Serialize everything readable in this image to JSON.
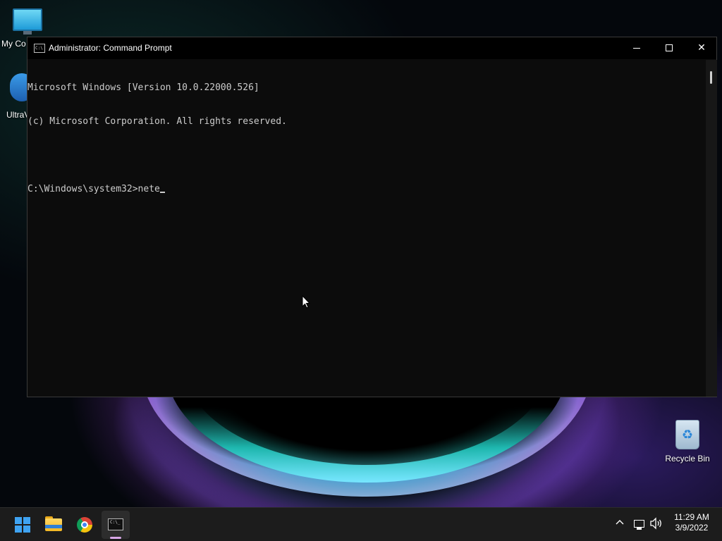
{
  "desktop": {
    "icons": [
      {
        "label": "My Co",
        "icon": "monitor-icon"
      },
      {
        "label": "UltraV",
        "icon": "ultraviewer-icon"
      },
      {
        "label": "Recycle Bin",
        "icon": "recycle-bin-icon"
      }
    ]
  },
  "window": {
    "title": "Administrator: Command Prompt",
    "app_icon_text": "C:\\",
    "controls": {
      "minimize": "minimize",
      "maximize": "maximize",
      "close": "✕"
    }
  },
  "console": {
    "lines": [
      "Microsoft Windows [Version 10.0.22000.526]",
      "(c) Microsoft Corporation. All rights reserved.",
      ""
    ],
    "prompt": "C:\\Windows\\system32>",
    "input": "nete"
  },
  "taskbar": {
    "apps": [
      {
        "name": "Start",
        "icon": "windows-start-icon"
      },
      {
        "name": "File Explorer",
        "icon": "folder-icon"
      },
      {
        "name": "Google Chrome",
        "icon": "chrome-icon"
      },
      {
        "name": "Command Prompt",
        "icon": "cmd-icon",
        "active": true
      }
    ],
    "cmd_icon_text": "C:\\_",
    "tray": {
      "chevron": "^",
      "time": "11:29 AM",
      "date": "3/9/2022"
    }
  },
  "colors": {
    "console_bg": "#0c0c0c",
    "console_text": "#cccccc",
    "titlebar_bg": "#000000",
    "taskbar_bg": "#1c1c1c",
    "start_blue": "#3fa3f2"
  }
}
